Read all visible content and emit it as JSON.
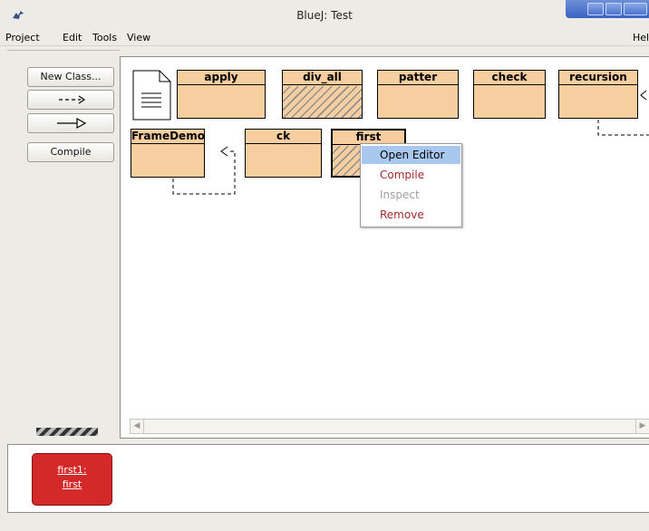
{
  "window": {
    "title": "BlueJ: Test",
    "app_icon": "bluej-bird-icon"
  },
  "menubar": {
    "items": [
      "Project",
      "Edit",
      "Tools",
      "View"
    ],
    "help": "Hel"
  },
  "toolbar": {
    "new_class": "New Class...",
    "uses_arrow": "--->",
    "inherits_arrow": "—▷",
    "compile": "Compile"
  },
  "classes": {
    "apply": "apply",
    "div_all": "div_all",
    "patter": "patter",
    "check": "check",
    "recursion": "recursion",
    "framedemo": "FrameDemo",
    "ck": "ck",
    "first": "first"
  },
  "context_menu": {
    "open_editor": "Open Editor",
    "compile": "Compile",
    "inspect": "Inspect",
    "remove": "Remove"
  },
  "object_bench": {
    "instance_name": "first1:",
    "instance_class": "first"
  },
  "colors": {
    "class_fill": "#f6ce9f",
    "object_fill": "#d32929",
    "menu_highlight": "#a9c8ef",
    "menu_action_text": "#a52a2a",
    "menu_disabled_text": "#a0a0a0"
  }
}
